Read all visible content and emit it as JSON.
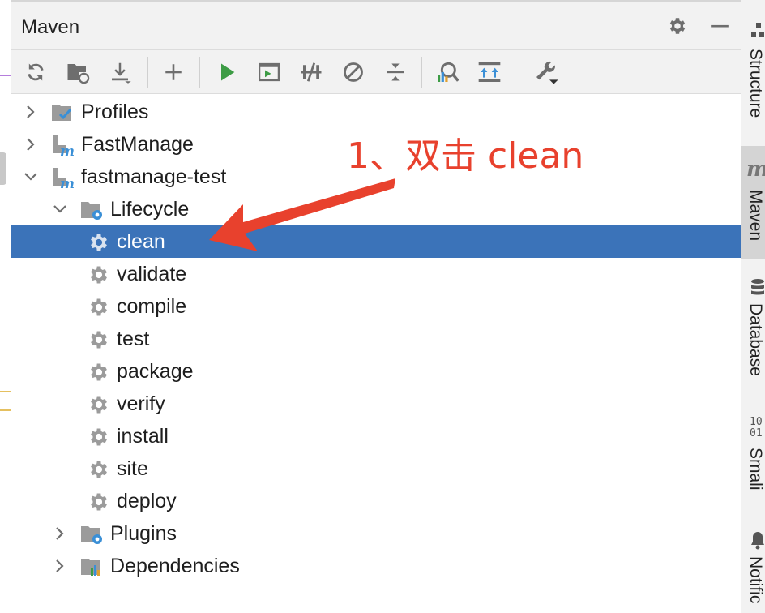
{
  "panel": {
    "title": "Maven",
    "title_icons": [
      "gear-icon",
      "minimize-icon"
    ]
  },
  "toolbar": {
    "tools": [
      {
        "name": "reload-all-projects",
        "icon": "refresh-icon"
      },
      {
        "name": "generate-sources",
        "icon": "folder-refresh-icon"
      },
      {
        "name": "download-sources",
        "icon": "download-icon"
      },
      {
        "name": "add-maven-project",
        "icon": "plus-icon"
      },
      {
        "name": "run-maven-build",
        "icon": "run-icon"
      },
      {
        "name": "execute-maven-goal",
        "icon": "terminal-icon"
      },
      {
        "name": "toggle-offline-mode",
        "icon": "offline-icon"
      },
      {
        "name": "skip-tests",
        "icon": "skip-icon"
      },
      {
        "name": "collapse-all",
        "icon": "collapse-icon"
      },
      {
        "name": "analyze-dependencies",
        "icon": "analyze-icon"
      },
      {
        "name": "show-dependencies",
        "icon": "diagram-icon"
      },
      {
        "name": "maven-settings",
        "icon": "wrench-icon"
      }
    ]
  },
  "tree": {
    "nodes": [
      {
        "label": "Profiles",
        "icon": "profiles-icon",
        "level": 0,
        "expanded": false
      },
      {
        "label": "FastManage",
        "icon": "maven-module-icon",
        "level": 0,
        "expanded": false
      },
      {
        "label": "fastmanage-test",
        "icon": "maven-module-icon",
        "level": 0,
        "expanded": true
      },
      {
        "label": "Lifecycle",
        "icon": "lifecycle-folder-icon",
        "level": 1,
        "expanded": true
      },
      {
        "label": "clean",
        "icon": "goal-gear-icon",
        "level": 2,
        "selected": true
      },
      {
        "label": "validate",
        "icon": "goal-gear-icon",
        "level": 2
      },
      {
        "label": "compile",
        "icon": "goal-gear-icon",
        "level": 2
      },
      {
        "label": "test",
        "icon": "goal-gear-icon",
        "level": 2
      },
      {
        "label": "package",
        "icon": "goal-gear-icon",
        "level": 2
      },
      {
        "label": "verify",
        "icon": "goal-gear-icon",
        "level": 2
      },
      {
        "label": "install",
        "icon": "goal-gear-icon",
        "level": 2
      },
      {
        "label": "site",
        "icon": "goal-gear-icon",
        "level": 2
      },
      {
        "label": "deploy",
        "icon": "goal-gear-icon",
        "level": 2
      },
      {
        "label": "Plugins",
        "icon": "plugins-folder-icon",
        "level": 1,
        "expanded": false
      },
      {
        "label": "Dependencies",
        "icon": "dependencies-folder-icon",
        "level": 1,
        "expanded": false
      }
    ]
  },
  "right_stripe": {
    "tabs": [
      {
        "label": "Structure",
        "icon": "structure-icon",
        "active": false
      },
      {
        "label": "Maven",
        "icon": "maven-m-icon",
        "active": true
      },
      {
        "label": "Database",
        "icon": "database-icon",
        "active": false
      },
      {
        "label": "Smali",
        "icon": "binary-icon",
        "icon_text": "10\n01",
        "active": false
      },
      {
        "label": "Notific",
        "icon": "bell-icon",
        "active": false
      }
    ]
  },
  "annotation": {
    "text": "1、双击 clean"
  },
  "colors": {
    "selection": "#3b73b9",
    "annotation": "#e8412d",
    "run_green": "#3d9c45",
    "maven_blue": "#3a8fd6"
  }
}
